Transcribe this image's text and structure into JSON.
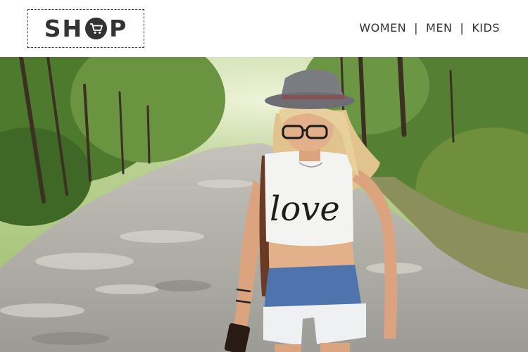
{
  "header": {
    "logo": {
      "text_before": "SH",
      "text_after": "P",
      "icon": "cart-icon",
      "icon_color": "#ffffff",
      "badge_color": "#333333"
    },
    "nav": {
      "items": [
        {
          "label": "WOMEN"
        },
        {
          "label": "MEN"
        },
        {
          "label": "KIDS"
        }
      ],
      "separator": "|"
    }
  },
  "hero": {
    "shirt_text": "love",
    "colors": {
      "foliage": "#5f8a3a",
      "road": "#a8a6a0",
      "skin": "#e2b08a",
      "hair": "#e6cf9c",
      "hat": "#7b7b82",
      "denim": "#4f73ad"
    }
  }
}
